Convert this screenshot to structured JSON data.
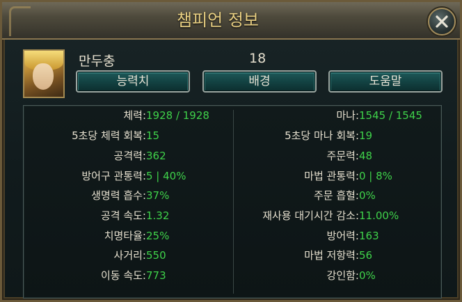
{
  "window": {
    "title": "챔피언 정보",
    "close_icon": "close-x-icon"
  },
  "champion": {
    "name": "만두충",
    "level": "18",
    "portrait_icon": "champion-portrait"
  },
  "tabs": [
    {
      "label": "능력치"
    },
    {
      "label": "배경"
    },
    {
      "label": "도움말"
    }
  ],
  "stats_left": [
    {
      "label": "체력:",
      "value": " 1928 / 1928"
    },
    {
      "label": "5초당 체력 회복:",
      "value": " 15"
    },
    {
      "label": "공격력:",
      "value": " 362"
    },
    {
      "label": "방어구 관통력:",
      "value": " 5 | 40%"
    },
    {
      "label": "생명력 흡수:",
      "value": " 37%"
    },
    {
      "label": "공격 속도:",
      "value": " 1.32"
    },
    {
      "label": "치명타율:",
      "value": " 25%"
    },
    {
      "label": "사거리:",
      "value": " 550"
    },
    {
      "label": "이동 속도:",
      "value": " 773"
    }
  ],
  "stats_right": [
    {
      "label": "마나:",
      "value": " 1545 / 1545"
    },
    {
      "label": "5초당 마나 회복:",
      "value": " 19"
    },
    {
      "label": "주문력:",
      "value": " 48"
    },
    {
      "label": "마법 관통력:",
      "value": " 0 | 8%"
    },
    {
      "label": "주문 흡혈:",
      "value": " 0%"
    },
    {
      "label": "재사용 대기시간 감소:",
      "value": " 11.00%"
    },
    {
      "label": "방어력:",
      "value": " 163"
    },
    {
      "label": "마법 저항력:",
      "value": " 56"
    },
    {
      "label": "강인함:",
      "value": " 0%"
    }
  ],
  "colors": {
    "title": "#e8cf82",
    "label": "#e6e0cf",
    "value": "#3fd24a",
    "frame_gold": "#a48d5c",
    "tab_teal": "#134343"
  }
}
